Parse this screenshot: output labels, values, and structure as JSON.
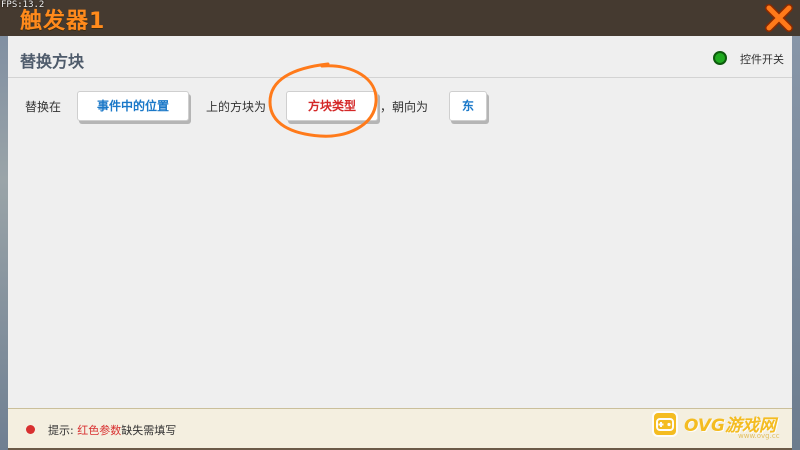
{
  "overlay": {
    "fps": "FPS:13.2"
  },
  "window": {
    "title": "触发器1"
  },
  "section": {
    "title": "替换方块"
  },
  "toggle": {
    "label": "控件开关",
    "color": "#1faa1f"
  },
  "action": {
    "prefix": "替换在",
    "position_value": "事件中的位置",
    "middle": "上的方块为",
    "block_value": "方块类型",
    "facing_label": "，朝向为",
    "facing_value": "东"
  },
  "footer": {
    "hint_label": "提示:",
    "hint_highlight": "红色参数",
    "hint_rest": "缺失需填写"
  },
  "watermark": {
    "text": "OVG游戏网",
    "subtext": "www.ovg.cc"
  },
  "colors": {
    "title_orange": "#ff8a1c",
    "param_blue": "#1a78c8",
    "param_red": "#d42828",
    "annotation_orange": "#ff7a1a"
  }
}
